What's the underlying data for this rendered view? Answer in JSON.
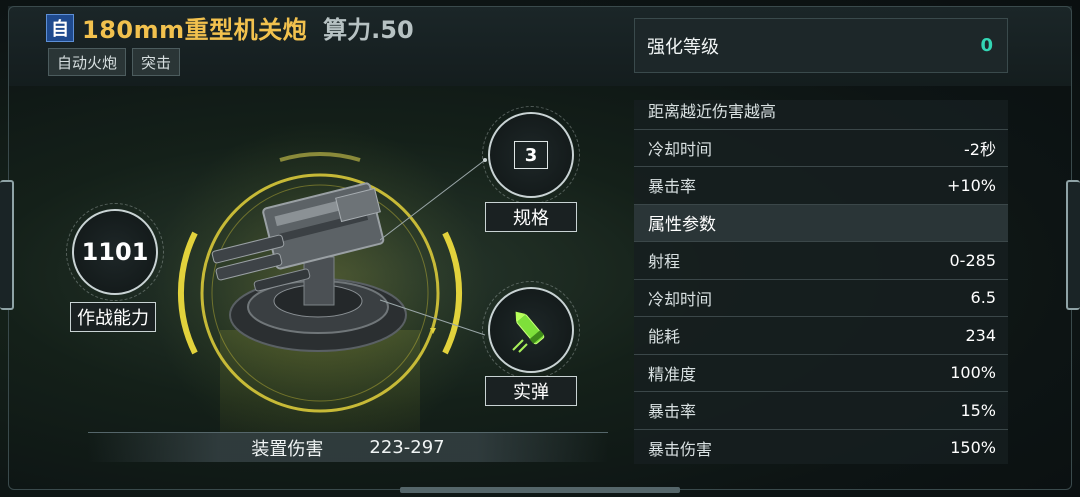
{
  "header": {
    "type_badge": "自",
    "weapon_name": "180mm重型机关炮",
    "power_label": "算力.50",
    "tags": [
      "自动火炮",
      "突击"
    ]
  },
  "combat": {
    "value": "1101",
    "label": "作战能力"
  },
  "spec": {
    "value": "3",
    "label": "规格"
  },
  "ammo": {
    "label": "实弹",
    "icon": "bullet-icon"
  },
  "damage": {
    "label": "装置伤害",
    "value": "223-297"
  },
  "enhance": {
    "label": "强化等级",
    "value": "0"
  },
  "attributes": {
    "effect_rows": [
      {
        "label": "距离越近伤害越高",
        "value": ""
      },
      {
        "label": "冷却时间",
        "value": "-2秒"
      },
      {
        "label": "暴击率",
        "value": "+10%"
      }
    ],
    "section_title": "属性参数",
    "param_rows": [
      {
        "label": "射程",
        "value": "0-285"
      },
      {
        "label": "冷却时间",
        "value": "6.5"
      },
      {
        "label": "能耗",
        "value": "234"
      },
      {
        "label": "精准度",
        "value": "100%"
      },
      {
        "label": "暴击率",
        "value": "15%"
      },
      {
        "label": "暴击伤害",
        "value": "150%"
      }
    ]
  },
  "colors": {
    "title": "#f2c14e",
    "enhance_value": "#33d6b4",
    "ring": "#d8c93a",
    "badge": "#1f4a8e"
  }
}
